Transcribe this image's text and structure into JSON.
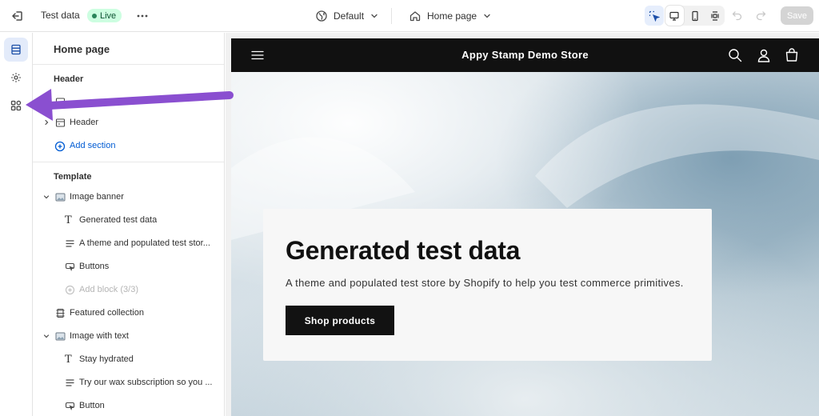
{
  "topbar": {
    "store_name": "Test data",
    "status_badge": "Live",
    "theme": "Default",
    "page": "Home page",
    "save_label": "Save"
  },
  "sidebar": {
    "title": "Home page",
    "header_heading": "Header",
    "header_items": [
      {
        "label": "Header",
        "icon": "section-icon"
      },
      {
        "label": "Add section",
        "icon": "plus-circle-icon"
      }
    ],
    "template_heading": "Template",
    "template_items": [
      {
        "label": "Image banner",
        "icon": "image-icon",
        "level": 0
      },
      {
        "label": "Generated test data",
        "icon": "text-icon",
        "level": 1
      },
      {
        "label": "A theme and populated test stor...",
        "icon": "paragraph-icon",
        "level": 1
      },
      {
        "label": "Buttons",
        "icon": "button-icon",
        "level": 1
      },
      {
        "label": "Add block (3/3)",
        "icon": "plus-circle-icon",
        "level": 1
      },
      {
        "label": "Featured collection",
        "icon": "section-icon",
        "level": 0
      },
      {
        "label": "Image with text",
        "icon": "image-icon",
        "level": 0
      },
      {
        "label": "Stay hydrated",
        "icon": "text-icon",
        "level": 1
      },
      {
        "label": "Try our wax subscription so you ...",
        "icon": "paragraph-icon",
        "level": 1
      },
      {
        "label": "Button",
        "icon": "button-icon",
        "level": 1
      }
    ]
  },
  "preview": {
    "store_title": "Appy Stamp Demo Store",
    "banner_heading": "Generated test data",
    "banner_text": "A theme and populated test store by Shopify to help you test commerce primitives.",
    "shop_button": "Shop products"
  },
  "colors": {
    "accent": "#005bd3",
    "live_badge_bg": "#cdfee1",
    "annotation_arrow": "#8a4fd0",
    "store_header": "#111111"
  }
}
